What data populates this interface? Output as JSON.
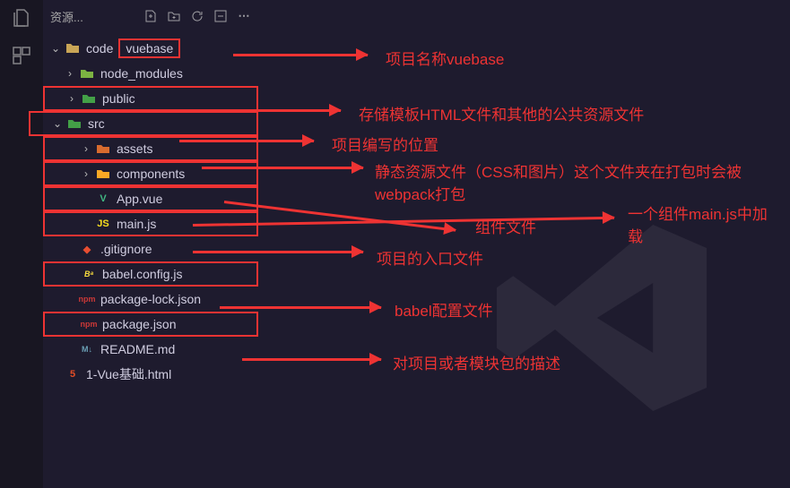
{
  "sidebar": {
    "title": "资源...",
    "header_icons": [
      "new-file-icon",
      "new-folder-icon",
      "refresh-icon",
      "collapse-icon",
      "more-icon"
    ]
  },
  "tree": {
    "root": {
      "label": "code",
      "expanded": true
    },
    "items": [
      {
        "name": "vuebase",
        "label": "vuebase",
        "indent": 0,
        "type": "folder",
        "expanded": true,
        "icon": "folder-open",
        "boxed": "label",
        "arrow_to": "anno0"
      },
      {
        "name": "node_modules",
        "label": "node_modules",
        "indent": 1,
        "type": "folder",
        "expanded": false,
        "icon": "folder-node"
      },
      {
        "name": "public",
        "label": "public",
        "indent": 1,
        "type": "folder",
        "expanded": false,
        "icon": "folder-public",
        "boxed": "row",
        "arrow_to": "anno1"
      },
      {
        "name": "src",
        "label": "src",
        "indent": 1,
        "type": "folder",
        "expanded": true,
        "icon": "folder-src",
        "boxed": "row",
        "arrow_to": "anno2"
      },
      {
        "name": "assets",
        "label": "assets",
        "indent": 2,
        "type": "folder",
        "expanded": false,
        "icon": "folder-assets",
        "boxed": "row",
        "arrow_to": "anno3"
      },
      {
        "name": "components",
        "label": "components",
        "indent": 2,
        "type": "folder",
        "expanded": false,
        "icon": "folder-comp",
        "boxed": "row",
        "arrow_to": "anno4"
      },
      {
        "name": "App.vue",
        "label": "App.vue",
        "indent": 2,
        "type": "file",
        "icon": "vue",
        "boxed": "row",
        "arrow_to": "anno5"
      },
      {
        "name": "main.js",
        "label": "main.js",
        "indent": 2,
        "type": "file",
        "icon": "js",
        "boxed": "row",
        "arrow_to": "anno6"
      },
      {
        "name": ".gitignore",
        "label": ".gitignore",
        "indent": 1,
        "type": "file",
        "icon": "git"
      },
      {
        "name": "babel.config.js",
        "label": "babel.config.js",
        "indent": 1,
        "type": "file",
        "icon": "babel",
        "boxed": "row",
        "arrow_to": "anno7"
      },
      {
        "name": "package-lock.json",
        "label": "package-lock.json",
        "indent": 1,
        "type": "file",
        "icon": "npm"
      },
      {
        "name": "package.json",
        "label": "package.json",
        "indent": 1,
        "type": "file",
        "icon": "npm",
        "boxed": "row",
        "arrow_to": "anno8"
      },
      {
        "name": "README.md",
        "label": "README.md",
        "indent": 1,
        "type": "file",
        "icon": "md"
      },
      {
        "name": "1-Vue基础.html",
        "label": "1-Vue基础.html",
        "indent": 0,
        "type": "file",
        "icon": "html"
      }
    ]
  },
  "annotations": {
    "anno0": "项目名称vuebase",
    "anno1": "存储模板HTML文件和其他的公共资源文件",
    "anno2": "项目编写的位置",
    "anno3": "静态资源文件（CSS和图片）这个文件夹在打包时会被webpack打包",
    "anno4": "组件文件",
    "anno5": "一个组件main.js中加载",
    "anno6": "项目的入口文件",
    "anno7": "babel配置文件",
    "anno8": "对项目或者模块包的描述"
  }
}
